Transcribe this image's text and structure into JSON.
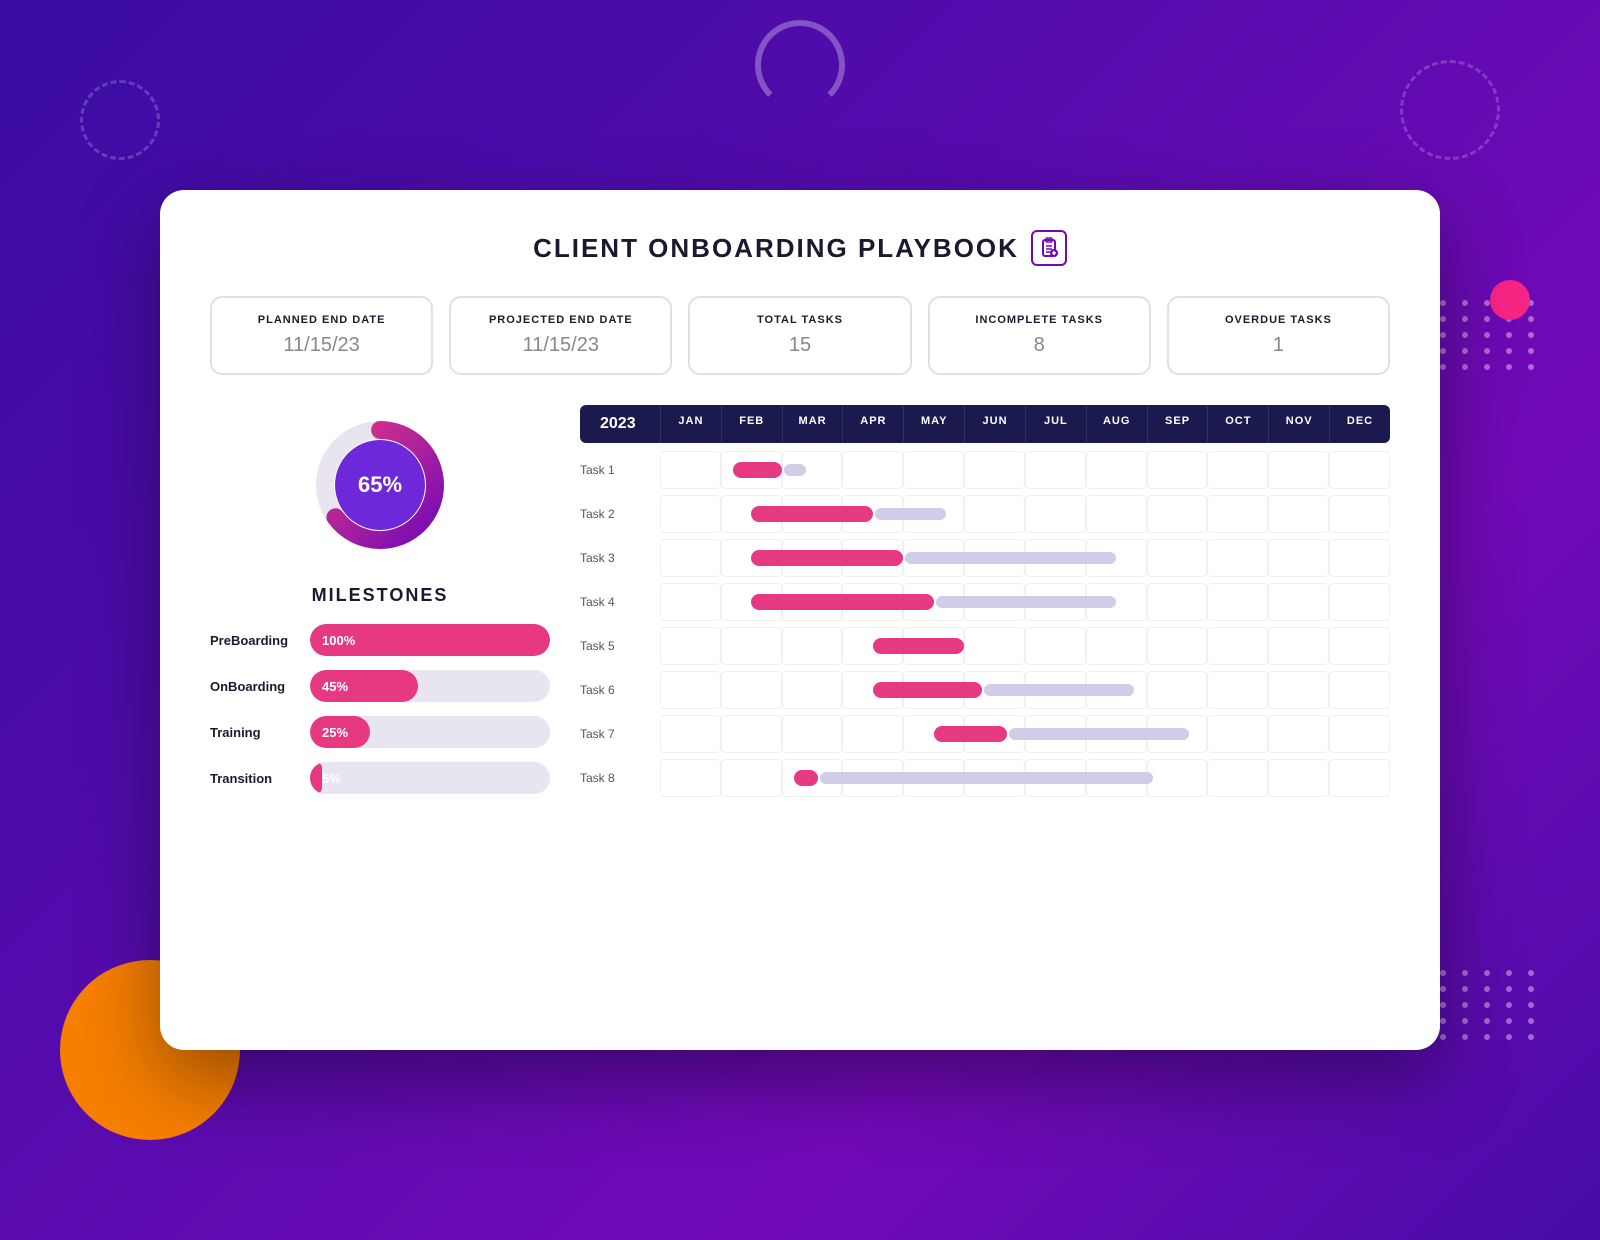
{
  "page": {
    "title": "CLIENT ONBOARDING PLAYBOOK",
    "clipboard_icon": "📋"
  },
  "stats": [
    {
      "id": "planned-end-date",
      "label": "PLANNED END DATE",
      "value": "11/15/23"
    },
    {
      "id": "projected-end-date",
      "label": "PROJECTED END DATE",
      "value": "11/15/23"
    },
    {
      "id": "total-tasks",
      "label": "TOTAL TASKS",
      "value": "15"
    },
    {
      "id": "incomplete-tasks",
      "label": "INCOMPLETE TASKS",
      "value": "8"
    },
    {
      "id": "overdue-tasks",
      "label": "OVERDUE TASKS",
      "value": "1"
    }
  ],
  "donut": {
    "percent": "65%",
    "completed": 65,
    "remaining": 35
  },
  "milestones": {
    "title": "MILESTONES",
    "items": [
      {
        "name": "PreBoarding",
        "percent": 100,
        "label": "100%"
      },
      {
        "name": "OnBoarding",
        "percent": 45,
        "label": "45%"
      },
      {
        "name": "Training",
        "percent": 25,
        "label": "25%"
      },
      {
        "name": "Transition",
        "percent": 5,
        "label": "5%"
      }
    ]
  },
  "gantt": {
    "year": "2023",
    "months": [
      "JAN",
      "FEB",
      "MAR",
      "APR",
      "MAY",
      "JUN",
      "JUL",
      "AUG",
      "SEP",
      "OCT",
      "NOV",
      "DEC"
    ],
    "tasks": [
      {
        "name": "Task 1",
        "pink_start": 1.2,
        "pink_width": 0.8,
        "gray_start": 2.0,
        "gray_width": 0.4
      },
      {
        "name": "Task 2",
        "pink_start": 1.5,
        "pink_width": 2.0,
        "gray_start": 3.5,
        "gray_width": 1.2
      },
      {
        "name": "Task 3",
        "pink_start": 1.5,
        "pink_width": 2.5,
        "gray_start": 4.0,
        "gray_width": 3.5
      },
      {
        "name": "Task 4",
        "pink_start": 1.5,
        "pink_width": 3.0,
        "gray_start": 4.5,
        "gray_width": 3.0
      },
      {
        "name": "Task 5",
        "pink_start": 3.5,
        "pink_width": 1.5,
        "gray_start": 5.0,
        "gray_width": 0
      },
      {
        "name": "Task 6",
        "pink_start": 3.5,
        "pink_width": 1.8,
        "gray_start": 5.3,
        "gray_width": 2.5
      },
      {
        "name": "Task 7",
        "pink_start": 4.5,
        "pink_width": 1.2,
        "gray_start": 5.7,
        "gray_width": 3.0
      },
      {
        "name": "Task 8",
        "pink_start": 2.2,
        "pink_width": 0.4,
        "gray_start": 2.6,
        "gray_width": 5.5
      }
    ]
  },
  "colors": {
    "dark_navy": "#1a1a4e",
    "purple": "#6d28d9",
    "pink": "#e63982",
    "gray_bar": "#d0cde8",
    "bg_purple": "#560bad",
    "orange": "#f77f00"
  }
}
